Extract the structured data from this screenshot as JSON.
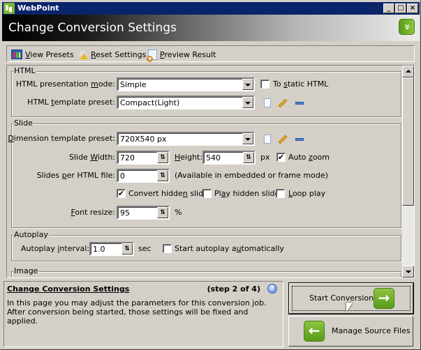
{
  "window": {
    "app_title": "WebPoint",
    "controls": {
      "minimize": "_",
      "maximize": "□",
      "close": "×"
    }
  },
  "header": {
    "title": "Change Conversion Settings",
    "collapse_icon": "»"
  },
  "toolbar": {
    "items": [
      {
        "label": "View Presets",
        "mnemonic": "V",
        "rest": "iew Presets",
        "icon": "grid-icon"
      },
      {
        "label": "Reset Settings",
        "mnemonic": "R",
        "rest": "eset Settings",
        "icon": "reset-warning-icon"
      },
      {
        "label": "Preview Result",
        "mnemonic": "P",
        "rest": "review Result",
        "icon": "preview-icon"
      }
    ]
  },
  "html_group": {
    "legend": "HTML",
    "presentation_mode": {
      "label_pre": "HTML presentation ",
      "label_mn": "m",
      "label_post": "ode:",
      "value": "Simple"
    },
    "to_static": {
      "label_pre": "To ",
      "label_mn": "s",
      "label_post": "tatic HTML",
      "checked": false
    },
    "template_preset": {
      "label_pre": "HTML ",
      "label_mn": "t",
      "label_post": "emplate preset:",
      "value": "Compact(Light)"
    }
  },
  "slide_group": {
    "legend": "Slide",
    "dimension_preset": {
      "label_mn": "D",
      "label_post": "imension template preset:",
      "value": "720X540 px"
    },
    "slide_width": {
      "label_pre": "Slide ",
      "label_mn": "W",
      "label_post": "idth:",
      "value": "720"
    },
    "height": {
      "label_mn": "H",
      "label_post": "eight:",
      "value": "540",
      "unit": "px"
    },
    "auto_zoom": {
      "label_pre": "Auto ",
      "label_mn": "z",
      "label_post": "oom",
      "checked": true
    },
    "slides_per_file": {
      "label_pre": "Slides ",
      "label_mn": "p",
      "label_post": "er HTML file:",
      "value": "0",
      "note": "(Available in embedded or frame mode)"
    },
    "convert_hidden": {
      "label_pre": "Convert hidde",
      "label_mn": "n",
      "label_post": " slides",
      "checked": true
    },
    "play_hidden": {
      "label_pre": "Pl",
      "label_mn": "a",
      "label_post": "y hidden slides",
      "checked": false
    },
    "loop_play": {
      "label_mn": "L",
      "label_post": "oop play",
      "checked": false
    },
    "font_resize": {
      "label_mn": "F",
      "label_post": "ont resize:",
      "value": "95",
      "unit": "%"
    }
  },
  "autoplay_group": {
    "legend": "Autoplay",
    "interval": {
      "label_pre": "Autoplay ",
      "label_mn": "i",
      "label_post": "nterval:",
      "value": "1.0",
      "unit": "sec"
    },
    "start_auto": {
      "label_pre": "Start autoplay a",
      "label_mn": "u",
      "label_post": "tomatically",
      "checked": false
    }
  },
  "image_group": {
    "legend": "Image"
  },
  "info": {
    "title": "Change Conversion Settings",
    "step": "(step 2 of 4)",
    "description": "In this page you may adjust the parameters for this conversion job. After conversion being started, those settings will be fixed and applied."
  },
  "buttons": {
    "start": {
      "label": "Start Conversion",
      "icon": "→"
    },
    "manage": {
      "label": "Manage Source Files",
      "icon": "←"
    }
  },
  "checkmark": "✔",
  "spin_glyph": "⇅"
}
